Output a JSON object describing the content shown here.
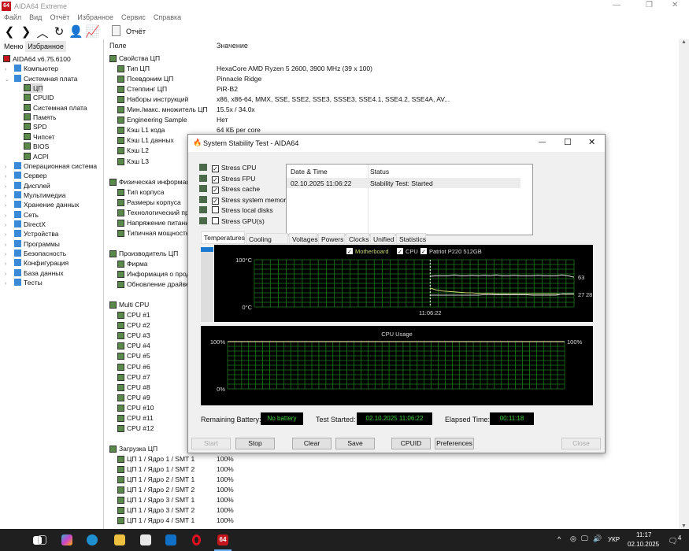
{
  "app": {
    "logo": "64",
    "title": "AIDA64 Extreme"
  },
  "menu": [
    "Файл",
    "Вид",
    "Отчёт",
    "Избранное",
    "Сервис",
    "Справка"
  ],
  "toolbar": {
    "report_label": "Отчёт"
  },
  "left_tabs": [
    "Меню",
    "Избранное"
  ],
  "tree": [
    {
      "label": "AIDA64 v6.75.6100",
      "level": 0
    },
    {
      "label": "Компьютер",
      "level": 1
    },
    {
      "label": "Системная плата",
      "level": 1
    },
    {
      "label": "ЦП",
      "level": 2,
      "selected": true
    },
    {
      "label": "CPUID",
      "level": 2
    },
    {
      "label": "Системная плата",
      "level": 2
    },
    {
      "label": "Память",
      "level": 2
    },
    {
      "label": "SPD",
      "level": 2
    },
    {
      "label": "Чипсет",
      "level": 2
    },
    {
      "label": "BIOS",
      "level": 2
    },
    {
      "label": "ACPI",
      "level": 2
    },
    {
      "label": "Операционная система",
      "level": 1
    },
    {
      "label": "Сервер",
      "level": 1
    },
    {
      "label": "Дисплей",
      "level": 1
    },
    {
      "label": "Мультимедиа",
      "level": 1
    },
    {
      "label": "Хранение данных",
      "level": 1
    },
    {
      "label": "Сеть",
      "level": 1
    },
    {
      "label": "DirectX",
      "level": 1
    },
    {
      "label": "Устройства",
      "level": 1
    },
    {
      "label": "Программы",
      "level": 1
    },
    {
      "label": "Безопасность",
      "level": 1
    },
    {
      "label": "Конфигурация",
      "level": 1
    },
    {
      "label": "База данных",
      "level": 1
    },
    {
      "label": "Тесты",
      "level": 1
    }
  ],
  "columns": {
    "field": "Поле",
    "value": "Значение"
  },
  "rows": [
    {
      "f": "Свойства ЦП",
      "v": "",
      "g": 1
    },
    {
      "f": "Тип ЦП",
      "v": "HexaCore AMD Ryzen 5 2600, 3900 MHz (39 x 100)"
    },
    {
      "f": "Псевдоним ЦП",
      "v": "Pinnacle Ridge"
    },
    {
      "f": "Степпинг ЦП",
      "v": "PiR-B2"
    },
    {
      "f": "Наборы инструкций",
      "v": "x86, x86-64, MMX, SSE, SSE2, SSE3, SSSE3, SSE4.1, SSE4.2, SSE4A, AV..."
    },
    {
      "f": "Мин./макс. множитель ЦП",
      "v": "15.5x / 34.0x"
    },
    {
      "f": "Engineering Sample",
      "v": "Нет"
    },
    {
      "f": "Кэш L1 кода",
      "v": "64 КБ per core"
    },
    {
      "f": "Кэш L1 данных",
      "v": ""
    },
    {
      "f": "Кэш L2",
      "v": ""
    },
    {
      "f": "Кэш L3",
      "v": ""
    },
    {
      "f": "",
      "v": ""
    },
    {
      "f": "Физическая информация",
      "v": "",
      "g": 1
    },
    {
      "f": "Тип корпуса",
      "v": ""
    },
    {
      "f": "Размеры корпуса",
      "v": ""
    },
    {
      "f": "Технологический процесс",
      "v": ""
    },
    {
      "f": "Напряжение питания",
      "v": ""
    },
    {
      "f": "Типичная мощность",
      "v": ""
    },
    {
      "f": "",
      "v": ""
    },
    {
      "f": "Производитель ЦП",
      "v": "",
      "g": 1
    },
    {
      "f": "Фирма",
      "v": ""
    },
    {
      "f": "Информация о продукте",
      "v": ""
    },
    {
      "f": "Обновление драйверов",
      "v": ""
    },
    {
      "f": "",
      "v": ""
    },
    {
      "f": "Multi CPU",
      "v": "",
      "g": 1
    },
    {
      "f": "CPU #1",
      "v": ""
    },
    {
      "f": "CPU #2",
      "v": ""
    },
    {
      "f": "CPU #3",
      "v": ""
    },
    {
      "f": "CPU #4",
      "v": ""
    },
    {
      "f": "CPU #5",
      "v": ""
    },
    {
      "f": "CPU #6",
      "v": ""
    },
    {
      "f": "CPU #7",
      "v": ""
    },
    {
      "f": "CPU #8",
      "v": ""
    },
    {
      "f": "CPU #9",
      "v": ""
    },
    {
      "f": "CPU #10",
      "v": ""
    },
    {
      "f": "CPU #11",
      "v": ""
    },
    {
      "f": "CPU #12",
      "v": ""
    },
    {
      "f": "",
      "v": ""
    },
    {
      "f": "Загрузка ЦП",
      "v": "",
      "g": 1
    },
    {
      "f": "ЦП 1 / Ядро 1 / SMT 1",
      "v": "100%"
    },
    {
      "f": "ЦП 1 / Ядро 1 / SMT 2",
      "v": "100%"
    },
    {
      "f": "ЦП 1 / Ядро 2 / SMT 1",
      "v": "100%"
    },
    {
      "f": "ЦП 1 / Ядро 2 / SMT 2",
      "v": "100%"
    },
    {
      "f": "ЦП 1 / Ядро 3 / SMT 1",
      "v": "100%"
    },
    {
      "f": "ЦП 1 / Ядро 3 / SMT 2",
      "v": "100%"
    },
    {
      "f": "ЦП 1 / Ядро 4 / SMT 1",
      "v": "100%"
    }
  ],
  "dialog": {
    "title": "System Stability Test - AIDA64",
    "stress": [
      {
        "label": "Stress CPU",
        "checked": true
      },
      {
        "label": "Stress FPU",
        "checked": true
      },
      {
        "label": "Stress cache",
        "checked": true
      },
      {
        "label": "Stress system memory",
        "checked": true
      },
      {
        "label": "Stress local disks",
        "checked": false
      },
      {
        "label": "Stress GPU(s)",
        "checked": false
      }
    ],
    "log_headers": [
      "Date & Time",
      "Status"
    ],
    "log": [
      {
        "time": "02.10.2025 11:06:22",
        "status": "Stability Test: Started"
      }
    ],
    "tabs": [
      "Temperatures",
      "Cooling Fans",
      "Voltages",
      "Powers",
      "Clocks",
      "Unified",
      "Statistics"
    ],
    "battery_label": "Remaining Battery:",
    "battery": "No battery",
    "started_label": "Test Started:",
    "started": "02.10.2025 11:06:22",
    "elapsed_label": "Elapsed Time:",
    "elapsed": "00:11:18",
    "buttons": {
      "start": "Start",
      "stop": "Stop",
      "clear": "Clear",
      "save": "Save",
      "cpuid": "CPUID",
      "preferences": "Preferences",
      "close": "Close"
    }
  },
  "chart_data": [
    {
      "type": "line",
      "title": "Temperatures",
      "ylim": [
        0,
        100
      ],
      "ytick_top": "100°C",
      "ytick_bottom": "0°C",
      "x_marker": "11:06:22",
      "series": [
        {
          "name": "Motherboard",
          "color": "#c8d878",
          "values": [
            40,
            36,
            34,
            33,
            32,
            31,
            30,
            30,
            29,
            29,
            29,
            28,
            28,
            28,
            28,
            28,
            28,
            28,
            28,
            28,
            28,
            28,
            27,
            27,
            27
          ],
          "last_label": "27"
        },
        {
          "name": "CPU",
          "color": "#e0e0e0",
          "values": [
            65,
            66,
            66,
            66,
            68,
            66,
            66,
            67,
            66,
            67,
            66,
            68,
            66,
            66,
            67,
            66,
            66,
            66,
            67,
            66,
            66,
            66,
            68,
            66,
            63
          ],
          "last_label": "63"
        },
        {
          "name": "Patriot P220 512GB",
          "color": "#d8d8d8",
          "values": [
            25,
            25,
            25,
            25,
            25,
            25,
            25,
            25,
            25,
            26,
            26,
            26,
            26,
            26,
            26,
            26,
            26,
            25,
            25,
            25,
            25,
            25,
            28,
            28,
            28
          ],
          "last_label": "28"
        }
      ]
    },
    {
      "type": "line",
      "title": "CPU Usage",
      "ylim": [
        0,
        100
      ],
      "ytick_top": "100%",
      "ytick_bottom": "0%",
      "value_label": "100%",
      "series": [
        {
          "name": "CPU Usage",
          "color": "#d8d8a0",
          "values": [
            100,
            100
          ]
        }
      ]
    }
  ],
  "taskbar": {
    "lang": "УКР",
    "time": "11:17",
    "date": "02.10.2025",
    "notif": "4"
  }
}
